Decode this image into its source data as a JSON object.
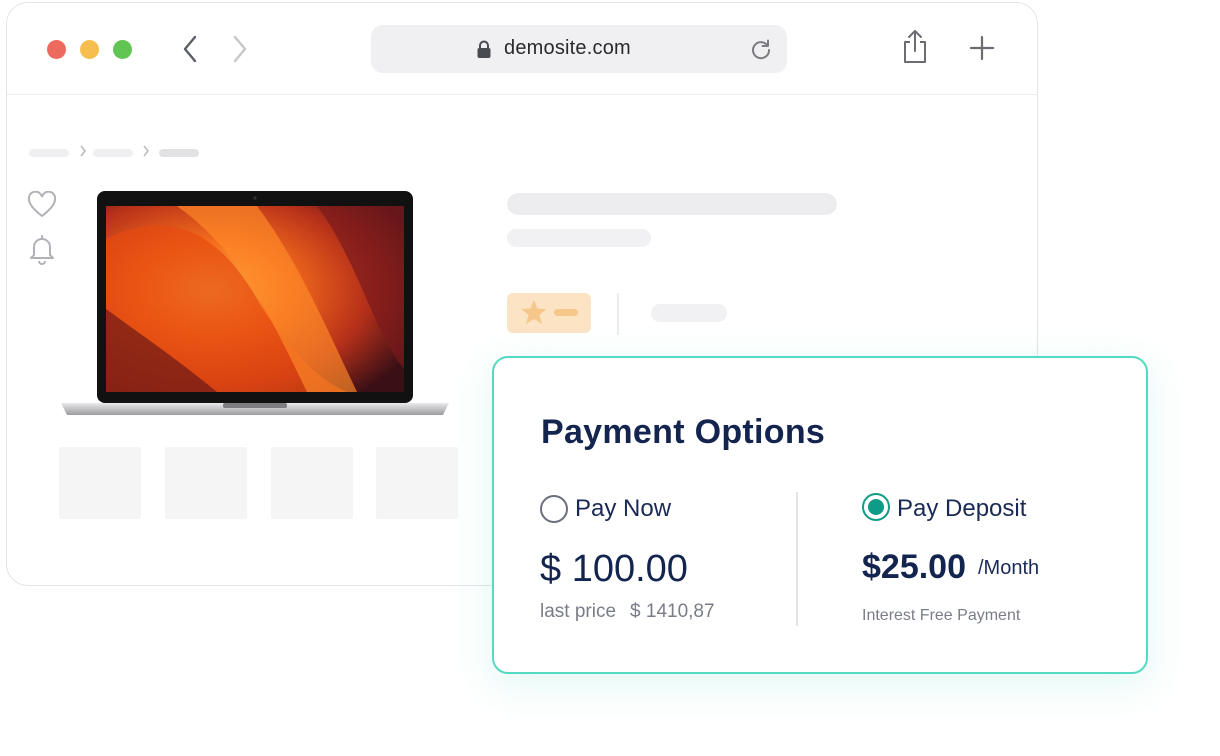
{
  "browser": {
    "url": "demosite.com",
    "icons": [
      "close-dot",
      "minimize-dot",
      "maximize-dot",
      "back-icon",
      "forward-icon",
      "lock-icon",
      "reload-icon",
      "share-icon",
      "plus-icon"
    ]
  },
  "product": {
    "side_icons": [
      "heart-icon",
      "bell-icon"
    ],
    "image": "laptop",
    "rating_accent": "#fbe3c4"
  },
  "payment": {
    "title": "Payment Options",
    "pay_now": {
      "label": "Pay Now",
      "selected": false,
      "price": "$ 100.00",
      "last_price_label": "last price",
      "last_price_value": "$ 1410,87"
    },
    "pay_deposit": {
      "label": "Pay Deposit",
      "selected": true,
      "amount": "$25.00",
      "unit": "/Month",
      "note": "Interest Free Payment"
    },
    "colors": {
      "accent": "#0f9c86",
      "border": "#54d9c2",
      "heading": "#13244f"
    }
  }
}
